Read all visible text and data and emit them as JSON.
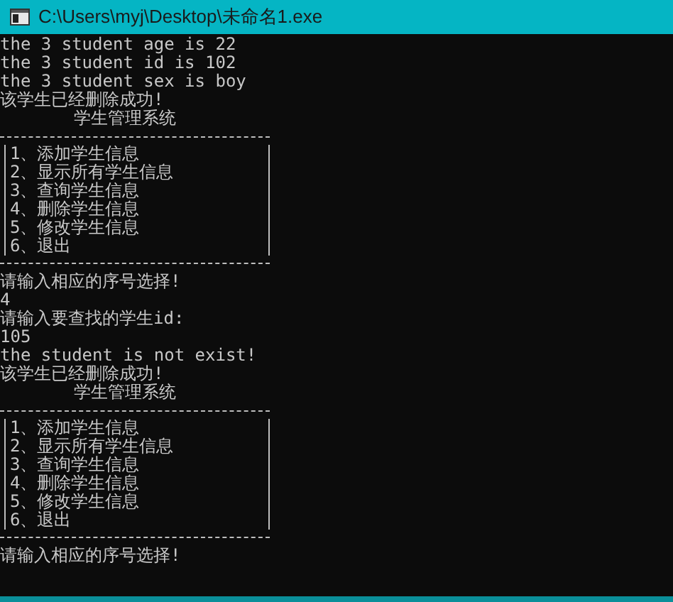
{
  "window": {
    "title": "C:\\Users\\myj\\Desktop\\未命名1.exe"
  },
  "console": {
    "lines": [
      {
        "kind": "text",
        "text": "the 3 student age is 22"
      },
      {
        "kind": "text",
        "text": "the 3 student id is 102"
      },
      {
        "kind": "text",
        "text": "the 3 student sex is boy"
      },
      {
        "kind": "text",
        "text": "该学生已经删除成功!"
      },
      {
        "kind": "title",
        "text": "学生管理系统"
      },
      {
        "kind": "menu",
        "items": [
          "1、添加学生信息",
          "2、显示所有学生信息",
          "3、查询学生信息",
          "4、删除学生信息",
          "5、修改学生信息",
          "6、退出"
        ]
      },
      {
        "kind": "text",
        "text": "请输入相应的序号选择!"
      },
      {
        "kind": "text",
        "text": "4"
      },
      {
        "kind": "text",
        "text": "请输入要查找的学生id:"
      },
      {
        "kind": "text",
        "text": "105"
      },
      {
        "kind": "text",
        "text": "the student is not exist!"
      },
      {
        "kind": "text",
        "text": "该学生已经删除成功!"
      },
      {
        "kind": "title",
        "text": "学生管理系统"
      },
      {
        "kind": "menu",
        "items": [
          "1、添加学生信息",
          "2、显示所有学生信息",
          "3、查询学生信息",
          "4、删除学生信息",
          "5、修改学生信息",
          "6、退出"
        ]
      },
      {
        "kind": "text",
        "text": "请输入相应的序号选择!"
      }
    ]
  }
}
